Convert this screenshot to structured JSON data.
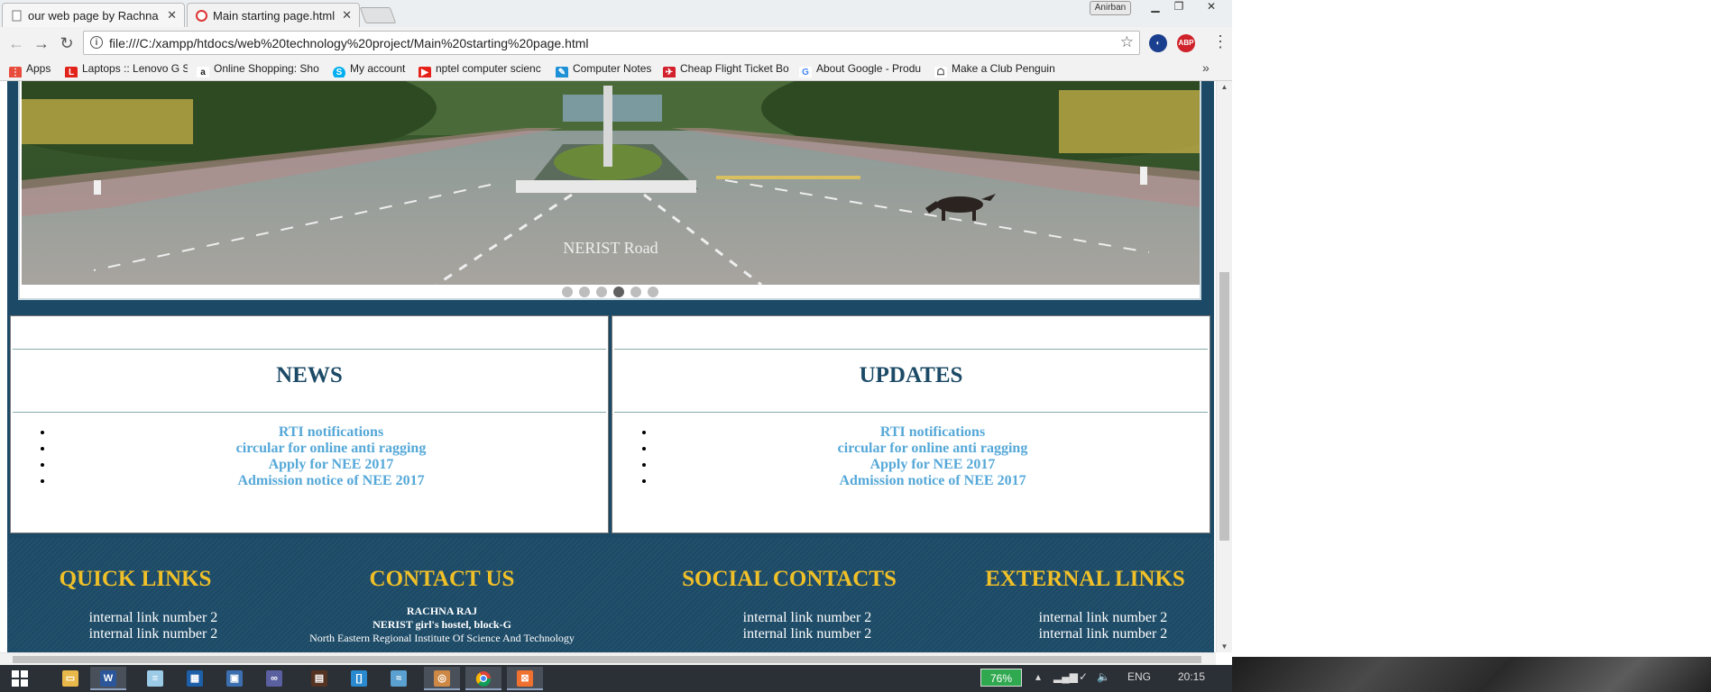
{
  "browser": {
    "tabs": [
      {
        "title": "our web page by Rachna",
        "active": false
      },
      {
        "title": "Main starting page.html",
        "active": true
      }
    ],
    "profile_name": "Anirban",
    "url": "file:///C:/xampp/htdocs/web%20technology%20project/Main%20starting%20page.html",
    "extensions": [
      "ABP"
    ],
    "bookmarks": [
      {
        "label": "Apps",
        "icon": "apps-grid-icon"
      },
      {
        "label": "Laptops :: Lenovo G S",
        "icon": "lenovo-icon"
      },
      {
        "label": "Online Shopping: Sho",
        "icon": "amazon-icon"
      },
      {
        "label": "My account",
        "icon": "skype-icon"
      },
      {
        "label": "nptel computer scienc",
        "icon": "youtube-icon"
      },
      {
        "label": "Computer Notes",
        "icon": "notes-icon"
      },
      {
        "label": "Cheap Flight Ticket Bo",
        "icon": "flight-icon"
      },
      {
        "label": "About Google - Produ",
        "icon": "google-icon"
      },
      {
        "label": "Make a Club Penguin",
        "icon": "penguin-icon"
      }
    ]
  },
  "page": {
    "slider": {
      "caption": "NERIST Road",
      "dot_count": 6,
      "active_dot": 4
    },
    "news": {
      "title": "NEWS",
      "items": [
        "RTI notifications",
        "circular for online anti ragging",
        "Apply for NEE 2017",
        "Admission notice of NEE 2017"
      ]
    },
    "updates": {
      "title": "UPDATES",
      "items": [
        "RTI notifications",
        "circular for online anti ragging",
        "Apply for NEE 2017",
        "Admission notice of NEE 2017"
      ]
    },
    "footer": {
      "quick_links": {
        "title": "QUICK LINKS",
        "links": [
          "internal link number 2",
          "internal link number 2"
        ]
      },
      "contact_us": {
        "title": "CONTACT US",
        "lines": [
          "RACHNA RAJ",
          "NERIST girl's hostel, block-G",
          "North Eastern Regional Institute Of Science And Technology"
        ]
      },
      "social_contacts": {
        "title": "SOCIAL CONTACTS",
        "links": [
          "internal link number 2",
          "internal link number 2"
        ]
      },
      "external_links": {
        "title": "EXTERNAL LINKS",
        "links": [
          "internal link number 2",
          "internal link number 2"
        ]
      }
    }
  },
  "colors": {
    "brand_navy": "#1c4a66",
    "footer_heading": "#f0c028",
    "link_blue": "#55a8d8"
  },
  "taskbar": {
    "battery_percent": "76%",
    "language": "ENG",
    "time": "20:15"
  }
}
